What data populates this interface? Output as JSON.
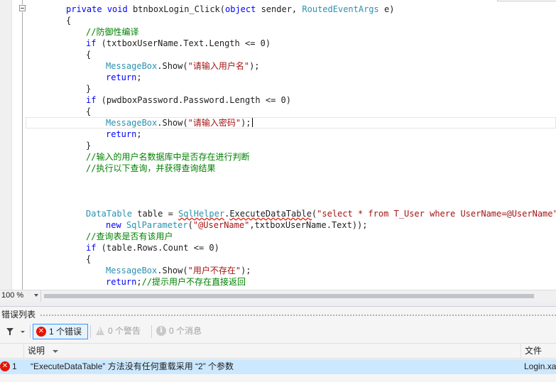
{
  "editor": {
    "lines": [
      {
        "indent": 0,
        "tokens": [
          {
            "t": "private",
            "c": "kw"
          },
          {
            "t": " "
          },
          {
            "t": "void",
            "c": "kw"
          },
          {
            "t": " btnboxLogin_Click("
          },
          {
            "t": "object",
            "c": "kw"
          },
          {
            "t": " sender, "
          },
          {
            "t": "RoutedEventArgs",
            "c": "cls"
          },
          {
            "t": " e)"
          }
        ]
      },
      {
        "indent": 0,
        "tokens": [
          {
            "t": "{"
          }
        ]
      },
      {
        "indent": 1,
        "tokens": [
          {
            "t": "//防御性编译",
            "c": "cmt"
          }
        ]
      },
      {
        "indent": 1,
        "tokens": [
          {
            "t": "if",
            "c": "kw"
          },
          {
            "t": " (txtboxUserName.Text.Length <= 0)"
          }
        ]
      },
      {
        "indent": 1,
        "tokens": [
          {
            "t": "{"
          }
        ]
      },
      {
        "indent": 2,
        "tokens": [
          {
            "t": "MessageBox",
            "c": "cls"
          },
          {
            "t": ".Show("
          },
          {
            "t": "\"请输入用户名\"",
            "c": "str"
          },
          {
            "t": ");"
          }
        ]
      },
      {
        "indent": 2,
        "tokens": [
          {
            "t": "return",
            "c": "kw"
          },
          {
            "t": ";"
          }
        ]
      },
      {
        "indent": 1,
        "tokens": [
          {
            "t": "}"
          }
        ]
      },
      {
        "indent": 1,
        "tokens": [
          {
            "t": "if",
            "c": "kw"
          },
          {
            "t": " (pwdboxPassword.Password.Length <= 0)"
          }
        ]
      },
      {
        "indent": 1,
        "tokens": [
          {
            "t": "{"
          }
        ]
      },
      {
        "indent": 2,
        "tokens": [
          {
            "t": "MessageBox",
            "c": "cls"
          },
          {
            "t": ".Show("
          },
          {
            "t": "\"请输入密码\"",
            "c": "str"
          },
          {
            "t": ");"
          },
          {
            "t": "",
            "c": "caret"
          }
        ]
      },
      {
        "indent": 2,
        "tokens": [
          {
            "t": "return",
            "c": "kw"
          },
          {
            "t": ";"
          }
        ]
      },
      {
        "indent": 1,
        "tokens": [
          {
            "t": "}"
          }
        ]
      },
      {
        "indent": 1,
        "tokens": [
          {
            "t": "//输入的用户名数据库中是否存在进行判断",
            "c": "cmt"
          }
        ]
      },
      {
        "indent": 1,
        "tokens": [
          {
            "t": "//执行以下查询，并获得查询结果",
            "c": "cmt"
          }
        ]
      },
      {
        "indent": 1,
        "tokens": []
      },
      {
        "indent": 1,
        "tokens": []
      },
      {
        "indent": 1,
        "tokens": []
      },
      {
        "indent": 1,
        "tokens": [
          {
            "t": "DataTable",
            "c": "cls"
          },
          {
            "t": " table = "
          },
          {
            "t": "SqlHelper",
            "c": "cls err"
          },
          {
            "t": "."
          },
          {
            "t": "ExecuteDataTable",
            "c": "err"
          },
          {
            "t": "("
          },
          {
            "t": "\"select * from T_User where UserName=@UserName\"",
            "c": "str"
          },
          {
            "t": ","
          }
        ]
      },
      {
        "indent": 2,
        "tokens": [
          {
            "t": "new",
            "c": "kw"
          },
          {
            "t": " "
          },
          {
            "t": "SqlParameter",
            "c": "cls"
          },
          {
            "t": "("
          },
          {
            "t": "\"@UserName\"",
            "c": "str"
          },
          {
            "t": ",txtboxUserName.Text));"
          }
        ]
      },
      {
        "indent": 1,
        "tokens": [
          {
            "t": "//查询表是否有该用户",
            "c": "cmt"
          }
        ]
      },
      {
        "indent": 1,
        "tokens": [
          {
            "t": "if",
            "c": "kw"
          },
          {
            "t": " (table.Rows.Count <= 0)"
          }
        ]
      },
      {
        "indent": 1,
        "tokens": [
          {
            "t": "{"
          }
        ]
      },
      {
        "indent": 2,
        "tokens": [
          {
            "t": "MessageBox",
            "c": "cls"
          },
          {
            "t": ".Show("
          },
          {
            "t": "\"用户不存在\"",
            "c": "str"
          },
          {
            "t": ");"
          }
        ]
      },
      {
        "indent": 2,
        "tokens": [
          {
            "t": "return",
            "c": "kw"
          },
          {
            "t": ";"
          },
          {
            "t": "//提示用户不存在直接返回",
            "c": "cmt"
          }
        ]
      }
    ]
  },
  "zoom": {
    "value": "100 %"
  },
  "error_list": {
    "title": "错误列表",
    "toolbar": {
      "errors_label": "1 个错误",
      "warnings_label": "0 个警告",
      "messages_label": "0 个消息"
    },
    "columns": {
      "description": "说明",
      "file": "文件"
    },
    "rows": [
      {
        "index": "1",
        "description": "“ExecuteDataTable” 方法没有任何重载采用 “2” 个参数",
        "file": "Login.xaml.cs"
      }
    ]
  },
  "icons": {
    "error": "error-icon",
    "warning": "warning-icon",
    "info": "info-icon",
    "filter": "filter-icon"
  },
  "colors": {
    "keyword": "#0000ff",
    "type": "#2b91af",
    "string": "#a31515",
    "comment": "#008000",
    "error": "#e51400",
    "selection": "#cce8ff"
  }
}
